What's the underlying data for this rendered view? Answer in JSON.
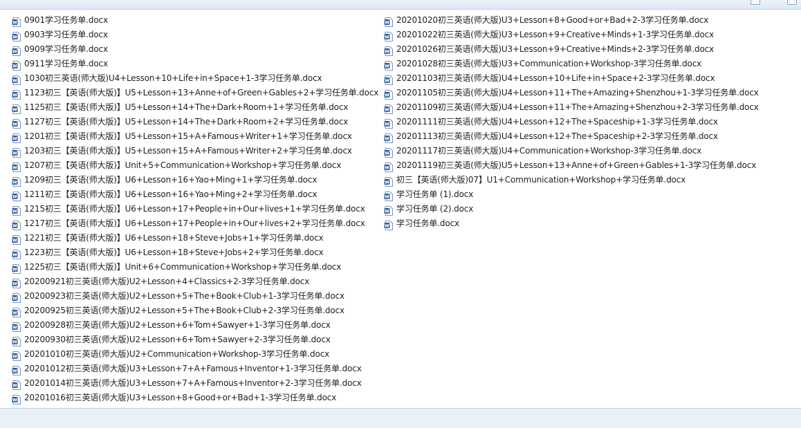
{
  "files_left": [
    "0901学习任务单.docx",
    "0903学习任务单.docx",
    "0909学习任务单.docx",
    "0911学习任务单.docx",
    "1030初三英语(师大版)U4+Lesson+10+Life+in+Space+1-3学习任务单.docx",
    "1123初三【英语(师大版)】U5+Lesson+13+Anne+of+Green+Gables+2+学习任务单.docx",
    "1125初三【英语(师大版)】U5+Lesson+14+The+Dark+Room+1+学习任务单.docx",
    "1127初三【英语(师大版)】U5+Lesson+14+The+Dark+Room+2+学习任务单.docx",
    "1201初三【英语(师大版)】U5+Lesson+15+A+Famous+Writer+1+学习任务单.docx",
    "1203初三【英语(师大版)】U5+Lesson+15+A+Famous+Writer+2+学习任务单.docx",
    "1207初三【英语(师大版)】Unit+5+Communication+Workshop+学习任务单.docx",
    "1209初三【英语(师大版)】U6+Lesson+16+Yao+Ming+1+学习任务单.docx",
    "1211初三【英语(师大版)】U6+Lesson+16+Yao+Ming+2+学习任务单.docx",
    "1215初三【英语(师大版)】U6+Lesson+17+People+in+Our+lives+1+学习任务单.docx",
    "1217初三【英语(师大版)】U6+Lesson+17+People+in+Our+lives+2+学习任务单.docx",
    "1221初三【英语(师大版)】U6+Lesson+18+Steve+Jobs+1+学习任务单.docx",
    "1223初三【英语(师大版)】U6+Lesson+18+Steve+Jobs+2+学习任务单.docx",
    "1225初三【英语(师大版)】Unit+6+Communication+Workshop+学习任务单.docx",
    "20200921初三英语(师大版)U2+Lesson+4+Classics+2-3学习任务单.docx",
    "20200923初三英语(师大版)U2+Lesson+5+The+Book+Club+1-3学习任务单.docx",
    "20200925初三英语(师大版)U2+Lesson+5+The+Book+Club+2-3学习任务单.docx",
    "20200928初三英语(师大版)U2+Lesson+6+Tom+Sawyer+1-3学习任务单.docx",
    "20200930初三英语(师大版)U2+Lesson+6+Tom+Sawyer+2-3学习任务单.docx",
    "20201010初三英语(师大版)U2+Communication+Workshop-3学习任务单.docx",
    "20201012初三英语(师大版)U3+Lesson+7+A+Famous+Inventor+1-3学习任务单.docx",
    "20201014初三英语(师大版)U3+Lesson+7+A+Famous+Inventor+2-3学习任务单.docx",
    "20201016初三英语(师大版)U3+Lesson+8+Good+or+Bad+1-3学习任务单.docx"
  ],
  "files_right": [
    "20201020初三英语(师大版)U3+Lesson+8+Good+or+Bad+2-3学习任务单.docx",
    "20201022初三英语(师大版)U3+Lesson+9+Creative+Minds+1-3学习任务单.docx",
    "20201026初三英语(师大版)U3+Lesson+9+Creative+Minds+2-3学习任务单.docx",
    "20201028初三英语(师大版)U3+Communication+Workshop-3学习任务单.docx",
    "20201103初三英语(师大版)U4+Lesson+10+Life+in+Space+2-3学习任务单.docx",
    "20201105初三英语(师大版)U4+Lesson+11+The+Amazing+Shenzhou+1-3学习任务单.docx",
    "20201109初三英语(师大版)U4+Lesson+11+The+Amazing+Shenzhou+2-3学习任务单.docx",
    "20201111初三英语(师大版)U4+Lesson+12+The+Spaceship+1-3学习任务单.docx",
    "20201113初三英语(师大版)U4+Lesson+12+The+Spaceship+2-3学习任务单.docx",
    "20201117初三英语(师大版)U4+Communication+Workshop-3学习任务单.docx",
    "20201119初三英语(师大版)U5+Lesson+13+Anne+of+Green+Gables+1-3学习任务单.docx",
    "初三【英语(师大版)07】U1+Communication+Workshop+学习任务单.docx",
    "学习任务单 (1).docx",
    "学习任务单 (2).docx",
    "学习任务单.docx"
  ],
  "icon": "word-document-icon",
  "colors": {
    "icon_blue": "#2b5797",
    "text": "#1e1e1e",
    "bottombar": "#eaf0f7"
  }
}
